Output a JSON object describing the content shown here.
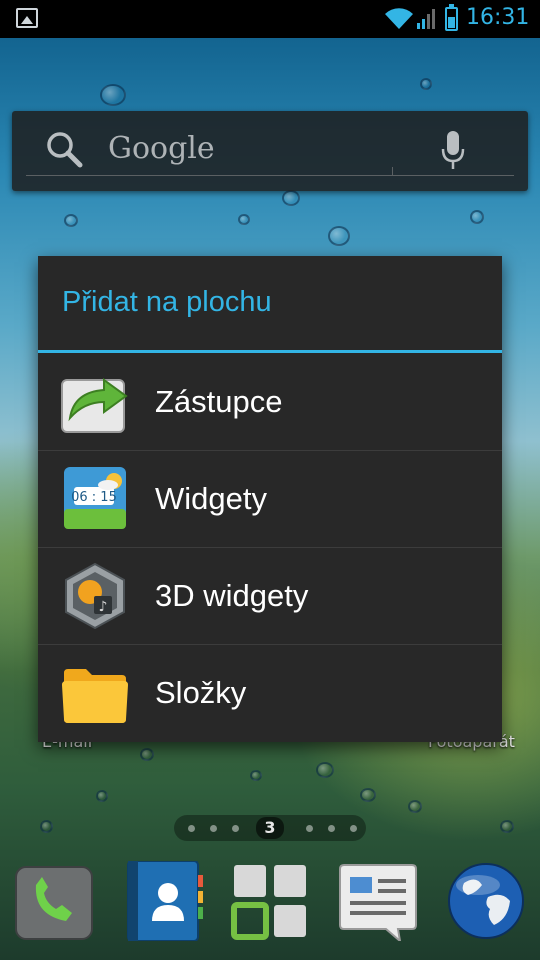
{
  "status_bar": {
    "time": "16:31",
    "icons": [
      "gallery-notification-icon",
      "wifi-icon",
      "signal-icon",
      "battery-icon"
    ],
    "accent_color": "#33b5e5"
  },
  "search_widget": {
    "text": "Google",
    "icons": [
      "search-icon",
      "mic-icon"
    ]
  },
  "dialog": {
    "title": "Přidat na plochu",
    "items": [
      {
        "label": "Zástupce",
        "icon": "shortcut-icon"
      },
      {
        "label": "Widgety",
        "icon": "widgets-icon"
      },
      {
        "label": "3D widgety",
        "icon": "3d-widgets-icon"
      },
      {
        "label": "Složky",
        "icon": "folder-icon"
      }
    ],
    "title_color": "#33b5e5",
    "background_color": "#282828"
  },
  "behind_dialog_labels": {
    "left": "E-mail",
    "right": "Fotoaparát"
  },
  "page_indicator": {
    "current_page": "3"
  },
  "dock": {
    "items": [
      "phone-icon",
      "contacts-icon",
      "apps-icon",
      "messages-icon",
      "browser-globe-icon"
    ]
  }
}
